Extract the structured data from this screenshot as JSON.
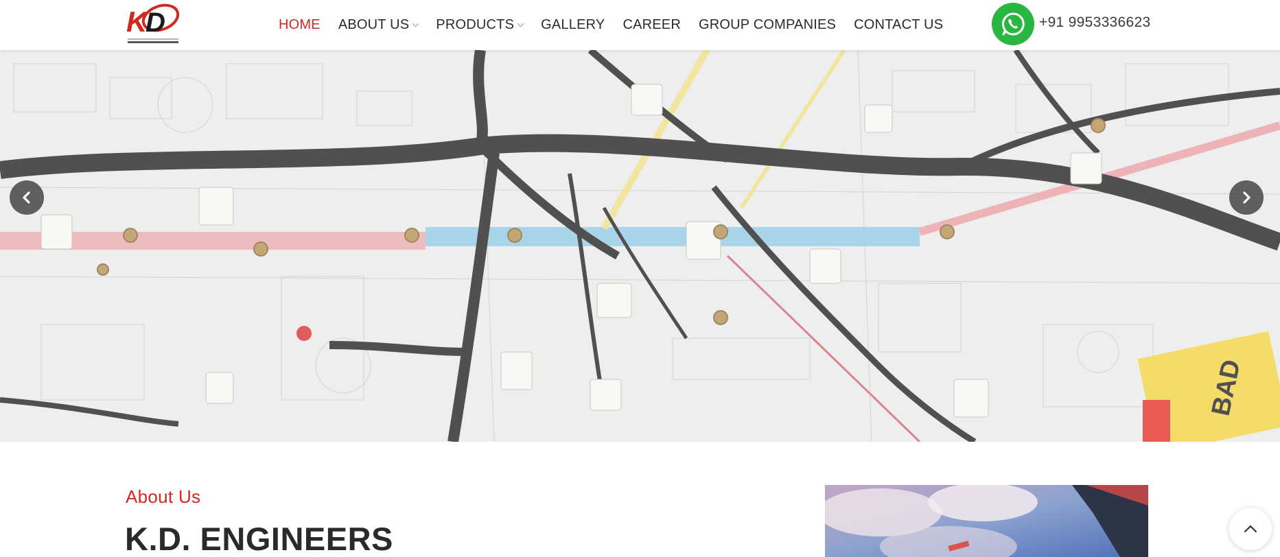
{
  "header": {
    "logo_alt": "KD",
    "nav": [
      {
        "label": "HOME",
        "active": true,
        "has_dropdown": false
      },
      {
        "label": "ABOUT US",
        "active": false,
        "has_dropdown": true
      },
      {
        "label": "PRODUCTS",
        "active": false,
        "has_dropdown": true
      },
      {
        "label": "GALLERY",
        "active": false,
        "has_dropdown": false
      },
      {
        "label": "CAREER",
        "active": false,
        "has_dropdown": false
      },
      {
        "label": "GROUP COMPANIES",
        "active": false,
        "has_dropdown": false
      },
      {
        "label": "CONTACT US",
        "active": false,
        "has_dropdown": false
      }
    ],
    "phone": "+91 9953336623",
    "whatsapp_icon": "whatsapp-icon"
  },
  "hero": {
    "prev_icon": "chevron-left-icon",
    "next_icon": "chevron-right-icon"
  },
  "about": {
    "label": "About Us",
    "title": "K.D. ENGINEERS"
  },
  "scroll_top_icon": "chevron-up-icon",
  "colors": {
    "accent": "#d2281f",
    "whatsapp": "#29b742",
    "text": "#2a2a2a"
  }
}
